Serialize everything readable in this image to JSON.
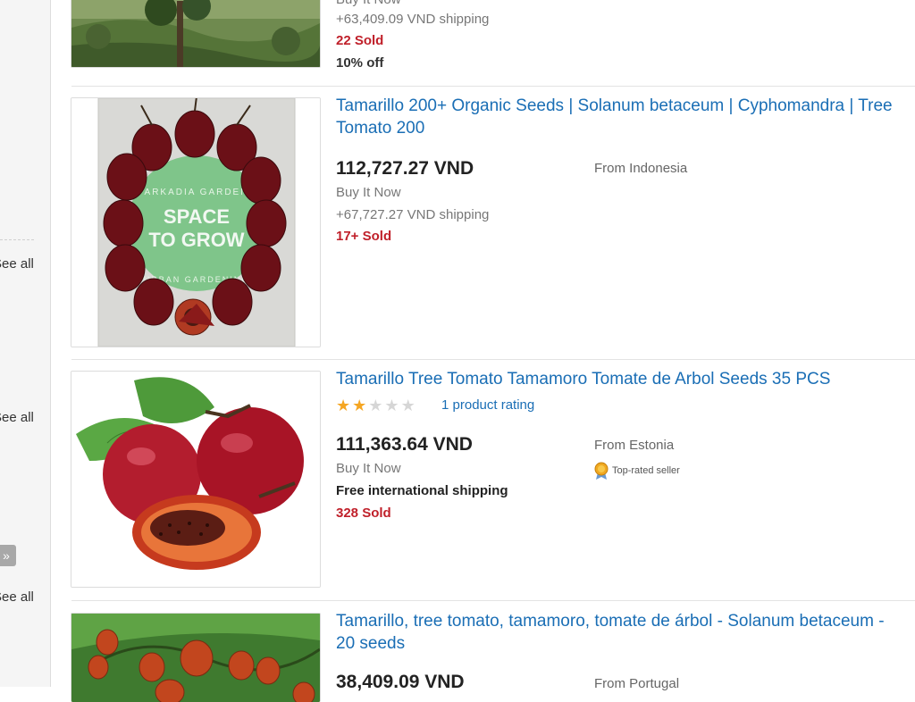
{
  "sidebar": {
    "see_all_1": "See all",
    "see_all_2": "See all",
    "see_all_3": "See all",
    "more_icon": "»"
  },
  "listings": [
    {
      "buy_format": "Buy It Now",
      "shipping": "+63,409.09 VND shipping",
      "sold": "22 Sold",
      "discount": "10% off",
      "image_icon": "hillside-tree-photo"
    },
    {
      "title": "Tamarillo 200+ Organic Seeds | Solanum betaceum | Cyphomandra | Tree Tomato 200",
      "price": "112,727.27 VND",
      "buy_format": "Buy It Now",
      "shipping": "+67,727.27 VND shipping",
      "sold": "17+ Sold",
      "origin": "From Indonesia",
      "image_icon": "tamarillo-circle-photo",
      "image_text": {
        "brand": "ARKADIA GARDEN",
        "line1": "SPACE",
        "line2": "TO GROW",
        "footer": "URBAN GARDENING"
      }
    },
    {
      "title": "Tamarillo Tree Tomato Tamamoro Tomate de Arbol Seeds 35 PCS",
      "rating_stars": 2,
      "rating_max": 5,
      "rating_link": "1 product rating",
      "price": "111,363.64 VND",
      "buy_format": "Buy It Now",
      "shipping": "Free international shipping",
      "sold": "328 Sold",
      "origin": "From Estonia",
      "badge": "Top-rated seller",
      "badge_icon": "medal-icon",
      "image_icon": "tamarillo-fruit-photo"
    },
    {
      "title": "Tamarillo, tree tomato, tamamoro, tomate de árbol - Solanum betaceum - 20 seeds",
      "price": "38,409.09 VND",
      "origin": "From Portugal",
      "image_icon": "tamarillo-tree-photo"
    }
  ],
  "colors": {
    "link": "#1a6eb5",
    "sold": "#c0202a",
    "star": "#f5a623",
    "star_off": "#d6d6d6"
  }
}
